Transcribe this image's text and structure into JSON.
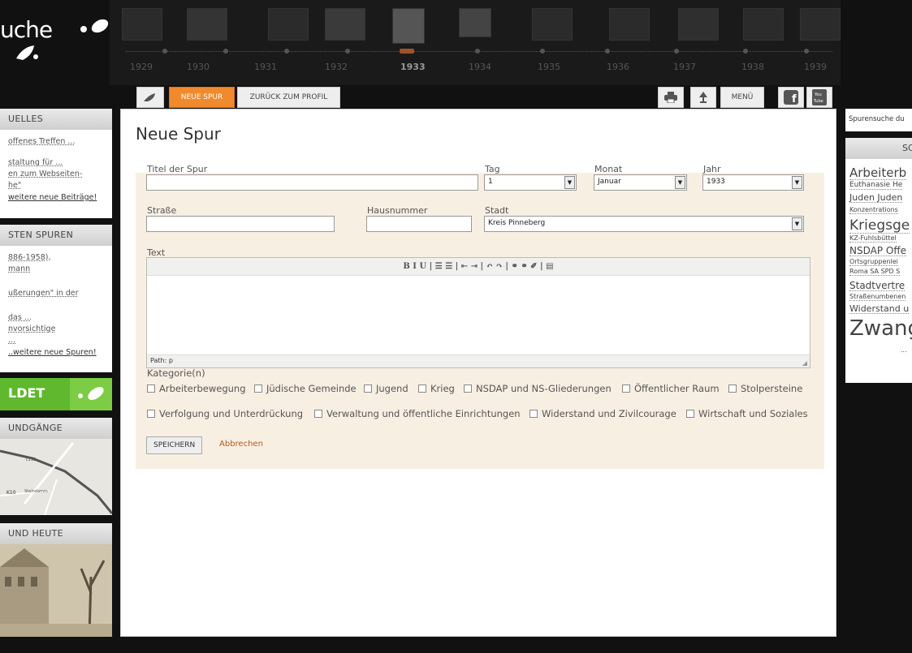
{
  "logo": {
    "text": "uche"
  },
  "timeline": {
    "years": [
      "1929",
      "1930",
      "1931",
      "1932",
      "1933",
      "1934",
      "1935",
      "1936",
      "1937",
      "1938",
      "1939"
    ],
    "active_year": "1933"
  },
  "toolbar": {
    "neue_spur": "NEUE SPUR",
    "zurueck": "ZURÜCK ZUM PROFIL",
    "menu": "MENÜ",
    "youtube": "You Tube"
  },
  "left": {
    "aktuelles": {
      "title": "UELLES",
      "items": [
        "offenes Treffen ...",
        "staltung für ...",
        "en zum Webseiten-",
        "he\"",
        "weitere neue Beiträge!"
      ]
    },
    "spuren": {
      "title": "STEN SPUREN",
      "items": [
        "886-1958),",
        "mann",
        "ußerungen\" in der",
        "das ...",
        "nvorsichtige",
        "...",
        "..weitere neue Spuren!"
      ]
    },
    "badge": "LDET",
    "rundgaenge": {
      "title": "UNDGÄNGE",
      "map_labels": [
        "K10",
        "Steindamm",
        "L112"
      ]
    },
    "heute": {
      "title": "UND HEUTE"
    }
  },
  "main": {
    "page_title": "Neue Spur",
    "fields": {
      "titel": "Titel der Spur",
      "tag": "Tag",
      "tag_value": "1",
      "monat": "Monat",
      "monat_value": "Januar",
      "jahr": "Jahr",
      "jahr_value": "1933",
      "strasse": "Straße",
      "hausnummer": "Hausnummer",
      "stadt": "Stadt",
      "stadt_value": "Kreis Pinneberg",
      "text": "Text"
    },
    "editor": {
      "toolbar": "B  I  U  | ☰ ☰ | ⇤ ⇥ | ↶ ↷ | ⚭ ⚭ ✐ | ▤",
      "status": "Path: p"
    },
    "kategorie_label": "Kategorie(n)",
    "categories": [
      "Arbeiterbewegung",
      "Jüdische Gemeinde",
      "Jugend",
      "Krieg",
      "NSDAP und NS-Gliederungen",
      "Öffentlicher Raum",
      "Stolpersteine",
      "Verfolgung und Unterdrückung",
      "Verwaltung und öffentliche Einrichtungen",
      "Widerstand und Zivilcourage",
      "Wirtschaft und Soziales"
    ],
    "save": "SPEICHERN",
    "cancel": "Abbrechen"
  },
  "right": {
    "text": "Spurensuche du",
    "tag_title": "SC",
    "tags": [
      "Arbeiterb",
      "Euthanasie He",
      "Juden Juden",
      "Konzentrations",
      "Kriegsge",
      "KZ-Fuhlsbüttel",
      "NSDAP Offe",
      "Ortsgruppenlei",
      "Roma SA SPD S",
      "Stadtvertre",
      "Straßenumbenen",
      "Widerstand u",
      "Zwang",
      "..."
    ]
  }
}
